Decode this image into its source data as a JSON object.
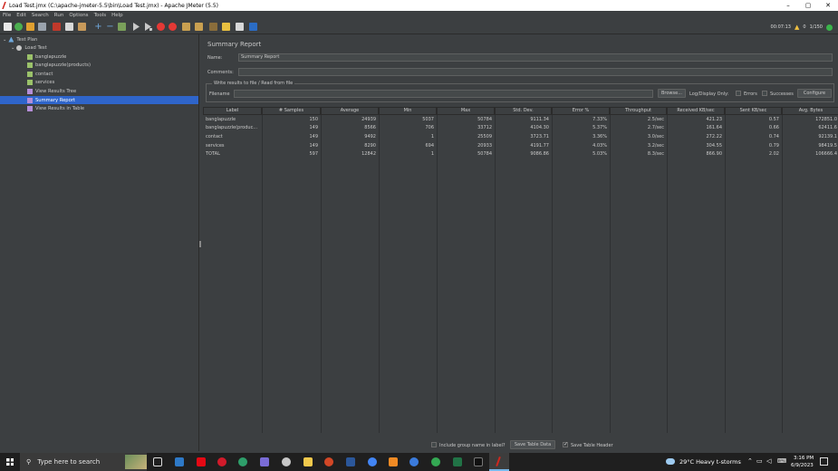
{
  "window": {
    "title": "Load Test.jmx (C:\\apache-jmeter-5.5\\bin\\Load Test.jmx) - Apache JMeter (5.5)",
    "minimize": "–",
    "maximize": "▢",
    "close": "✕"
  },
  "menu": [
    "File",
    "Edit",
    "Search",
    "Run",
    "Options",
    "Tools",
    "Help"
  ],
  "toolbar_right": {
    "elapsed": "00:07:13",
    "warnings": "0",
    "threads": "1/150"
  },
  "tree": {
    "test_plan": "Test Plan",
    "load_test": "Load Test",
    "items": [
      "banglapuzzle",
      "banglapuzzle(products)",
      "contact",
      "services",
      "View Results Tree",
      "Summary Report",
      "View Results in Table"
    ]
  },
  "panel": {
    "title": "Summary Report",
    "name_label": "Name:",
    "name_value": "Summary Report",
    "comments_label": "Comments:",
    "comments_value": "",
    "file_section": "Write results to file / Read from file",
    "filename_label": "Filename",
    "browse": "Browse...",
    "log_display": "Log/Display Only:",
    "errors": "Errors",
    "successes": "Successes",
    "configure": "Configure"
  },
  "table": {
    "headers": [
      "Label",
      "# Samples",
      "Average",
      "Min",
      "Max",
      "Std. Dev.",
      "Error %",
      "Throughput",
      "Received KB/sec",
      "Sent KB/sec",
      "Avg. Bytes"
    ],
    "rows": [
      [
        "banglapuzzle",
        "150",
        "24939",
        "5037",
        "50784",
        "9111.34",
        "7.33%",
        "2.5/sec",
        "421.23",
        "0.57",
        "172851.0"
      ],
      [
        "banglapuzzle(produc...",
        "149",
        "8566",
        "706",
        "33712",
        "4104.30",
        "5.37%",
        "2.7/sec",
        "161.64",
        "0.66",
        "62411.6"
      ],
      [
        "contact",
        "149",
        "9492",
        "1",
        "25509",
        "3723.71",
        "3.36%",
        "3.0/sec",
        "272.22",
        "0.74",
        "92139.1"
      ],
      [
        "services",
        "149",
        "8290",
        "694",
        "20933",
        "4191.77",
        "4.03%",
        "3.2/sec",
        "304.55",
        "0.79",
        "98419.5"
      ],
      [
        "TOTAL",
        "597",
        "12842",
        "1",
        "50784",
        "9086.86",
        "5.03%",
        "8.3/sec",
        "866.90",
        "2.02",
        "106666.4"
      ]
    ]
  },
  "bottom": {
    "include_group": "Include group name in label?",
    "save_table": "Save Table Data",
    "save_header": "Save Table Header"
  },
  "taskbar": {
    "search_placeholder": "Type here to search",
    "weather": "29°C  Heavy t-storms",
    "time": "3:16 PM",
    "date": "6/9/2023"
  }
}
